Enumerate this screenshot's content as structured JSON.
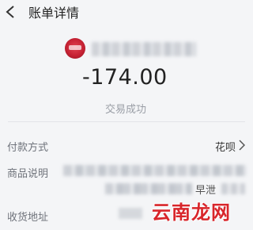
{
  "header": {
    "title": "账单详情",
    "back_icon": "back-arrow-icon"
  },
  "merchant": {
    "avatar_color": "#c62234"
  },
  "transaction": {
    "amount": "-174.00",
    "status": "交易成功"
  },
  "details": {
    "payment_method_label": "付款方式",
    "payment_method_value": "花呗",
    "description_label": "商品说明",
    "description_visible_text": "早泄",
    "address_label": "收货地址"
  },
  "watermark": "云南龙网"
}
